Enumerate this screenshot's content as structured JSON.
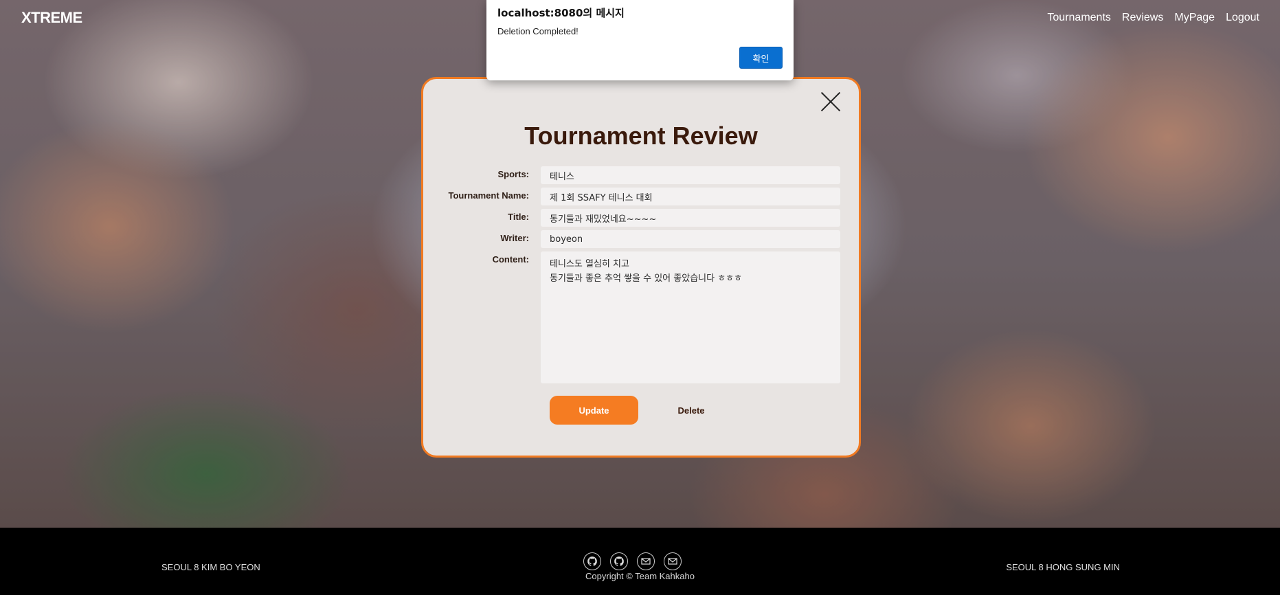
{
  "nav": {
    "brand": "XTREME",
    "links": [
      "Tournaments",
      "Reviews",
      "MyPage",
      "Logout"
    ]
  },
  "modal": {
    "title": "Tournament Review",
    "fields": {
      "sports": {
        "label": "Sports:",
        "value": "테니스"
      },
      "tournament_name": {
        "label": "Tournament Name:",
        "value": "제 1회 SSAFY 테니스 대회"
      },
      "title": {
        "label": "Title:",
        "value": "동기들과 재밌었네요~~~~"
      },
      "writer": {
        "label": "Writer:",
        "value": "boyeon"
      },
      "content": {
        "label": "Content:",
        "value": "테니스도 열심히 치고\n동기들과 좋은 추억 쌓을 수 있어 좋았습니다 ㅎㅎㅎ"
      }
    },
    "update_label": "Update",
    "delete_label": "Delete"
  },
  "alert": {
    "title": "localhost:8080의 메시지",
    "message": "Deletion Completed!",
    "ok_label": "확인"
  },
  "footer": {
    "left": "SEOUL 8 KIM BO YEON",
    "right": "SEOUL 8 HONG SUNG MIN",
    "copyright": "Copyright © Team Kahkaho",
    "icons": [
      "github-icon",
      "github-icon",
      "mail-icon",
      "mail-icon"
    ]
  },
  "colors": {
    "accent": "#f57c22",
    "modal_border": "#f07a22",
    "title": "#3a1a0c",
    "alert_button": "#0a6fd0"
  }
}
